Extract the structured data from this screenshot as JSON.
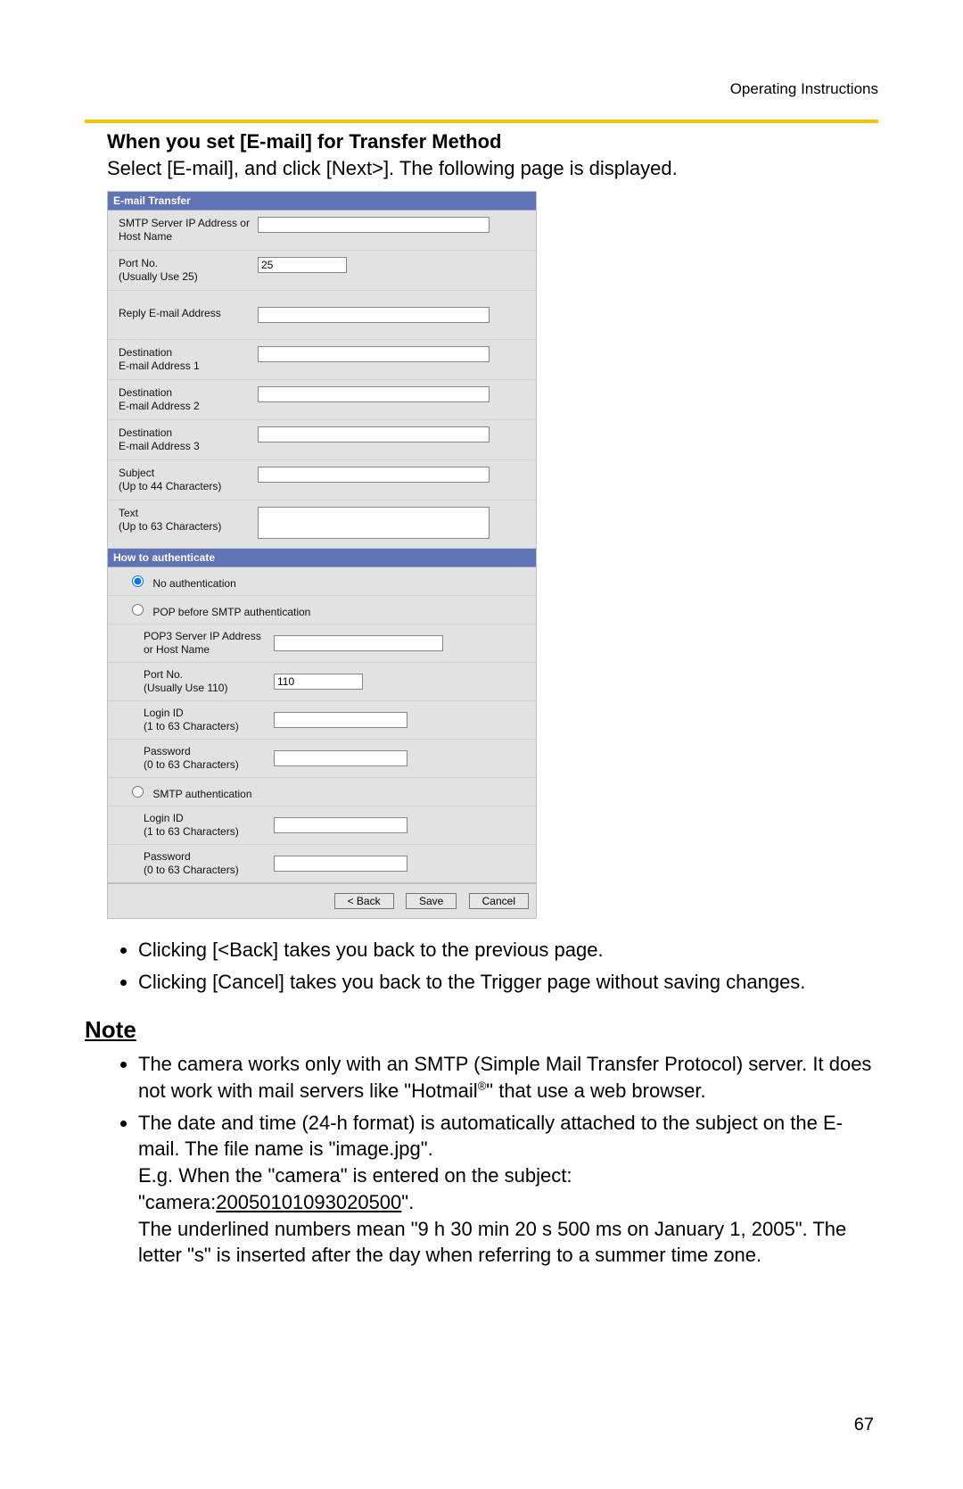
{
  "header": {
    "right": "Operating Instructions"
  },
  "heading": "When you set [E-mail] for Transfer Method",
  "intro": "Select [E-mail], and click [Next>]. The following page is displayed.",
  "panel": {
    "section1_title": "E-mail Transfer",
    "smtp_label": "SMTP Server IP Address or Host Name",
    "port_label": "Port No.\n(Usually Use 25)",
    "port_value": "25",
    "reply_label": "Reply E-mail Address",
    "dest1_label": "Destination\nE-mail Address 1",
    "dest2_label": "Destination\nE-mail Address 2",
    "dest3_label": "Destination\nE-mail Address 3",
    "subject_label": "Subject\n(Up to 44 Characters)",
    "text_label": "Text\n(Up to 63 Characters)",
    "section2_title": "How to authenticate",
    "radio_none": "No authentication",
    "radio_pop": "POP before SMTP authentication",
    "pop3_label": "POP3 Server IP Address or Host Name",
    "pop3_port_label": "Port No.\n(Usually Use 110)",
    "pop3_port_value": "110",
    "login_label": "Login ID\n(1 to 63 Characters)",
    "pass_label": "Password\n(0 to 63 Characters)",
    "radio_smtp": "SMTP authentication",
    "btn_back": "< Back",
    "btn_save": "Save",
    "btn_cancel": "Cancel"
  },
  "bullets1": [
    "Clicking [<Back] takes you back to the previous page.",
    "Clicking [Cancel] takes you back to the Trigger page without saving changes."
  ],
  "note_heading": "Note",
  "notes": {
    "n1a": "The camera works only with an SMTP (Simple Mail Transfer Protocol) server. It does not work with mail servers like \"Hotmail",
    "n1b": "\" that use a web browser.",
    "reg": "®",
    "n2a": "The date and time (24-h format) is automatically attached to the subject on the E-mail. The file name is \"image.jpg\".",
    "n2b": "E.g. When the \"camera\" is entered on the subject:",
    "n2c_pre": "\"camera:",
    "n2c_underlined": "20050101093020500",
    "n2c_post": "\".",
    "n2d": "The underlined numbers mean \"9 h 30 min 20 s 500 ms on January 1, 2005\". The letter \"s\" is inserted after the day when referring to a summer time zone."
  },
  "pagenum": "67"
}
